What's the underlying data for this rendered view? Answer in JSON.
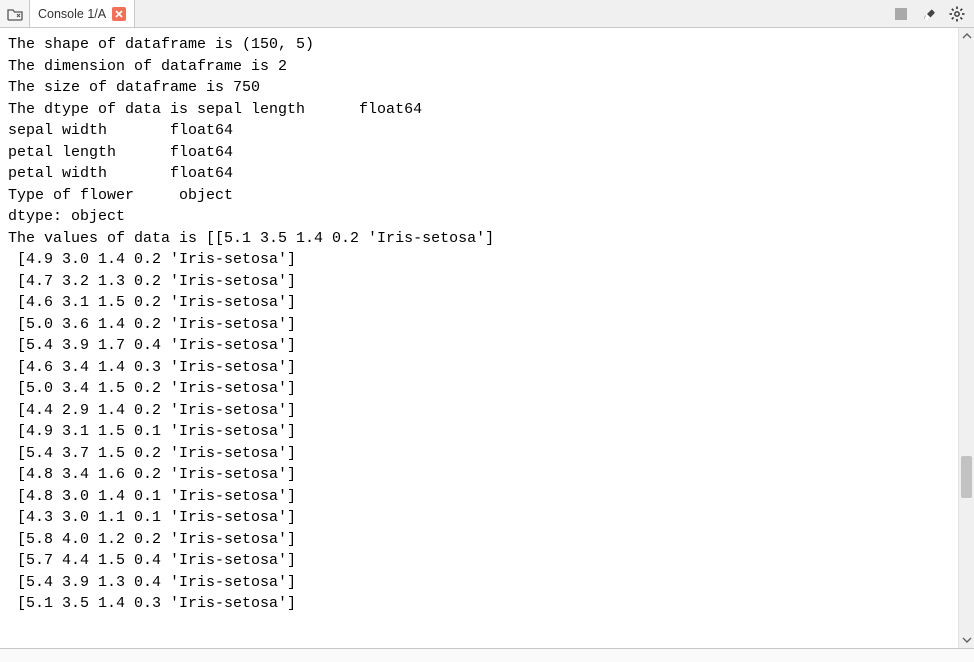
{
  "tabbar": {
    "tab_label": "Console 1/A"
  },
  "console": {
    "prefix_shape": "The shape of dataframe is ",
    "shape_value": "(150, 5)",
    "prefix_dim": "The dimension of dataframe is ",
    "dim_value": "2",
    "prefix_size": "The size of dataframe is ",
    "size_value": "750",
    "dtype_header": "The dtype of data is ",
    "dtype_lines": [
      "sepal length      float64",
      "sepal width       float64",
      "petal length      float64",
      "petal width       float64",
      "Type of flower     object",
      "dtype: object"
    ],
    "values_header": "The values of data is ",
    "values_first": "[[5.1 3.5 1.4 0.2 'Iris-setosa']",
    "rows": [
      "[4.9 3.0 1.4 0.2 'Iris-setosa']",
      "[4.7 3.2 1.3 0.2 'Iris-setosa']",
      "[4.6 3.1 1.5 0.2 'Iris-setosa']",
      "[5.0 3.6 1.4 0.2 'Iris-setosa']",
      "[5.4 3.9 1.7 0.4 'Iris-setosa']",
      "[4.6 3.4 1.4 0.3 'Iris-setosa']",
      "[5.0 3.4 1.5 0.2 'Iris-setosa']",
      "[4.4 2.9 1.4 0.2 'Iris-setosa']",
      "[4.9 3.1 1.5 0.1 'Iris-setosa']",
      "[5.4 3.7 1.5 0.2 'Iris-setosa']",
      "[4.8 3.4 1.6 0.2 'Iris-setosa']",
      "[4.8 3.0 1.4 0.1 'Iris-setosa']",
      "[4.3 3.0 1.1 0.1 'Iris-setosa']",
      "[5.8 4.0 1.2 0.2 'Iris-setosa']",
      "[5.7 4.4 1.5 0.4 'Iris-setosa']",
      "[5.4 3.9 1.3 0.4 'Iris-setosa']",
      "[5.1 3.5 1.4 0.3 'Iris-setosa']"
    ]
  }
}
